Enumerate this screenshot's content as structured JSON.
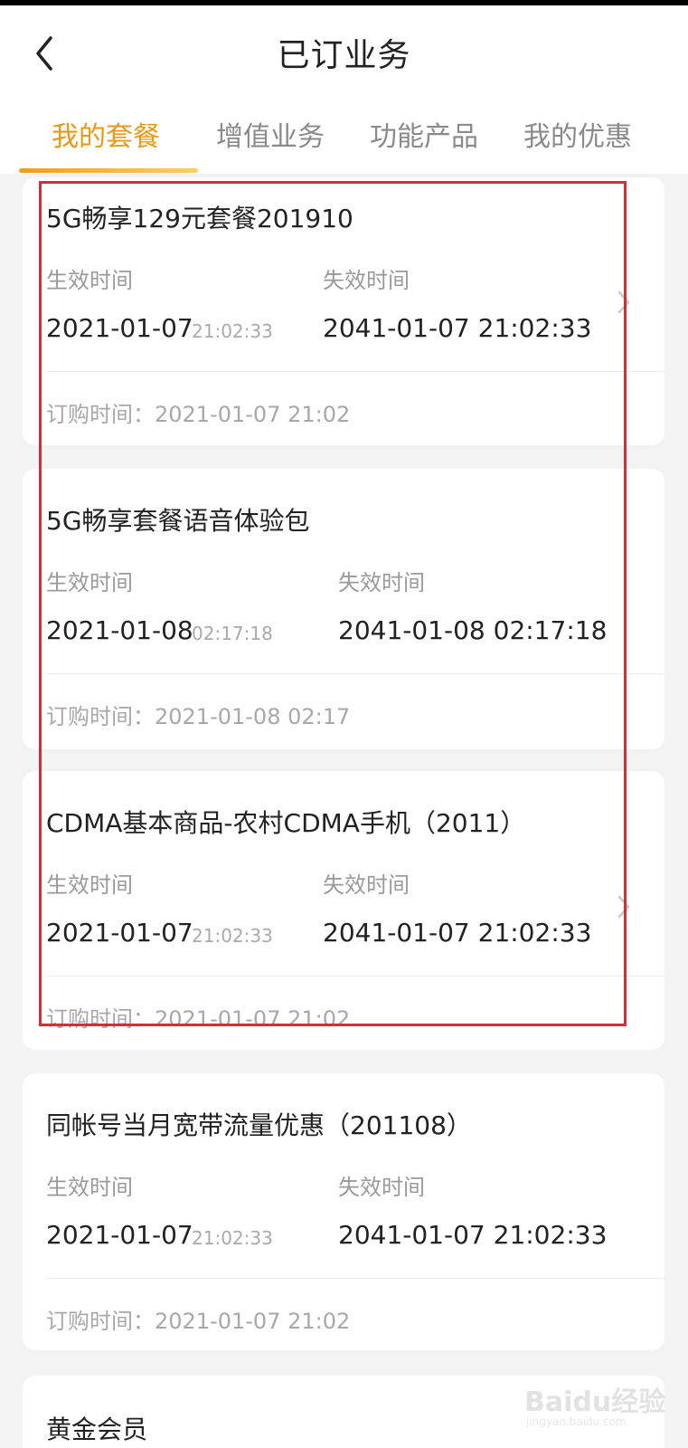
{
  "header": {
    "title": "已订业务",
    "tabs": [
      {
        "label": "我的套餐",
        "active": true
      },
      {
        "label": "增值业务",
        "active": false
      },
      {
        "label": "功能产品",
        "active": false
      },
      {
        "label": "我的优惠",
        "active": false
      }
    ]
  },
  "labels": {
    "effective": "生效时间",
    "expire": "失效时间"
  },
  "cards": [
    {
      "name": "5G畅享129元套餐201910",
      "effective_date": "2021-01-07",
      "effective_time": "21:02:33",
      "expire": "2041-01-07 21:02:33",
      "order": "订购时间：2021-01-07 21:02"
    },
    {
      "name": "5G畅享套餐语音体验包",
      "effective_date": "2021-01-08",
      "effective_time": "02:17:18",
      "expire": "2041-01-08 02:17:18",
      "order": "订购时间：2021-01-08 02:17"
    },
    {
      "name": "CDMA基本商品-农村CDMA手机（2011）",
      "effective_date": "2021-01-07",
      "effective_time": "21:02:33",
      "expire": "2041-01-07 21:02:33",
      "order": "订购时间：2021-01-07 21:02"
    },
    {
      "name": "同帐号当月宽带流量优惠（201108）",
      "effective_date": "2021-01-07",
      "effective_time": "21:02:33",
      "expire": "2041-01-07 21:02:33",
      "order": "订购时间：2021-01-07 21:02"
    },
    {
      "name": "黄金会员"
    }
  ],
  "watermark": {
    "text": "Baidu经验",
    "sub": "jingyan.baidu.com"
  },
  "colors": {
    "accent": "#e69a17",
    "highlight_box": "#d0303a"
  },
  "icons": {
    "back": "chevron-left-icon",
    "row_arrow": "chevron-right-icon"
  }
}
